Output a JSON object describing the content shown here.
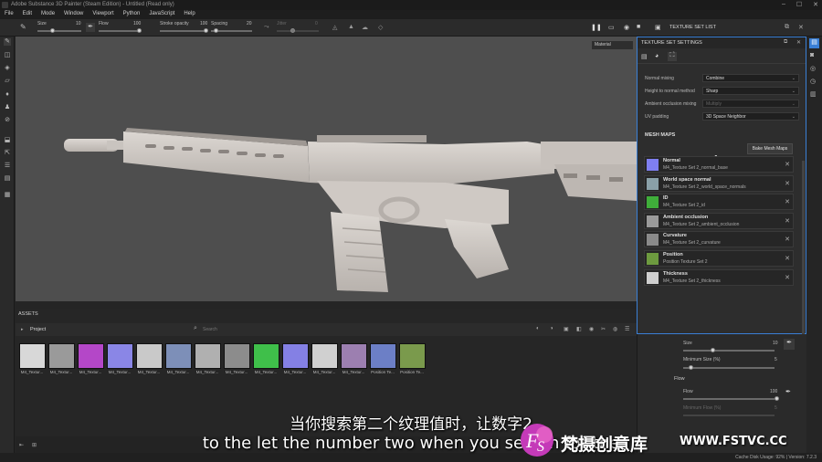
{
  "window": {
    "title": "Adobe Substance 3D Painter (Steam Edition) - Untitled (Read only)"
  },
  "menu": [
    "File",
    "Edit",
    "Mode",
    "Window",
    "Viewport",
    "Python",
    "JavaScript",
    "Help"
  ],
  "toolbar": {
    "size_label": "Size",
    "size_value": "10",
    "flow_label": "Flow",
    "flow_value": "100",
    "stroke_opacity_label": "Stroke opacity",
    "stroke_opacity_value": "100",
    "spacing_label": "Spacing",
    "spacing_value": "20",
    "jitter_label": "Jitter",
    "jitter_value": "0"
  },
  "top_right": {
    "texture_set_list": "TEXTURE SET LIST"
  },
  "viewport": {
    "material_mode": "Material"
  },
  "texture_set_settings": {
    "title": "TEXTURE SET SETTINGS",
    "rows": [
      {
        "label": "Normal mixing",
        "value": "Combine",
        "enabled": true
      },
      {
        "label": "Height to normal method",
        "value": "Sharp",
        "enabled": true
      },
      {
        "label": "Ambient occlusion mixing",
        "value": "Multiply",
        "enabled": false
      },
      {
        "label": "UV padding",
        "value": "3D Space Neighbor",
        "enabled": true
      }
    ],
    "mesh_maps_heading": "MESH MAPS",
    "bake_button": "Bake Mesh Maps",
    "maps": [
      {
        "name": "Normal",
        "file": "M4_Texture Set 2_normal_base",
        "color": "#7f7ff0"
      },
      {
        "name": "World space normal",
        "file": "M4_Texture Set 2_world_space_normals",
        "color": "#8aa0a8"
      },
      {
        "name": "ID",
        "file": "M4_Texture Set 2_id",
        "color": "#3fae3a"
      },
      {
        "name": "Ambient occlusion",
        "file": "M4_Texture Set 2_ambient_occlusion",
        "color": "#9a9a9a"
      },
      {
        "name": "Curvature",
        "file": "M4_Texture Set 2_curvature",
        "color": "#8a8a8a"
      },
      {
        "name": "Position",
        "file": "Position Texture Set 2",
        "color": "#6d9a3f"
      },
      {
        "name": "Thickness",
        "file": "M4_Texture Set 2_thickness",
        "color": "#cfcfcf"
      }
    ]
  },
  "properties": {
    "size_label": "Size",
    "size_value": "10",
    "min_size_label": "Minimum Size (%)",
    "min_size_value": "5",
    "flow_section": "Flow",
    "flow_label": "Flow",
    "flow_value": "100",
    "min_flow_label": "Minimum Flow (%)",
    "min_flow_value": "5"
  },
  "assets": {
    "title": "ASSETS",
    "project_label": "Project",
    "search_placeholder": "Search",
    "thumbnails": [
      {
        "label": "M4_Textur...",
        "color": "#d8d8d8"
      },
      {
        "label": "M4_Textur...",
        "color": "#9a9a9a"
      },
      {
        "label": "M4_Textur...",
        "color": "#b447c8"
      },
      {
        "label": "M4_Textur...",
        "color": "#8a86e6"
      },
      {
        "label": "M4_Textur...",
        "color": "#c9c9c9"
      },
      {
        "label": "M4_Textur...",
        "color": "#7d8fb8"
      },
      {
        "label": "M4_Textur...",
        "color": "#b0b0b0"
      },
      {
        "label": "M4_Textur...",
        "color": "#8c8c8c"
      },
      {
        "label": "M4_Textur...",
        "color": "#3fbf4a"
      },
      {
        "label": "M4_Textur...",
        "color": "#8480e4"
      },
      {
        "label": "M4_Textur...",
        "color": "#d0d0d0"
      },
      {
        "label": "M4_Textur...",
        "color": "#9c7fb0"
      },
      {
        "label": "Position Te...",
        "color": "#6c7fc6"
      },
      {
        "label": "Position Te...",
        "color": "#7a9a4c"
      }
    ]
  },
  "subtitles": {
    "chinese": "当你搜索第二个纹理值时，让数字2",
    "english": "to the let the number two when you search for the"
  },
  "watermark": {
    "brand": "梵摄创意库",
    "url": "WWW.FSTVC.CC"
  },
  "status": {
    "text": "Cache Disk Usage:  92% | Version: 7.2.3"
  }
}
